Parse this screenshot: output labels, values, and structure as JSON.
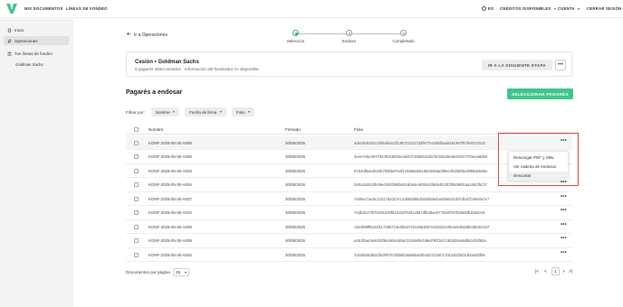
{
  "topnav": {
    "mis_documentos": "MIS DOCUMENTOS",
    "lineas_fondeo": "LÍNEAS DE FONDEO",
    "language": "ES",
    "creditos": "CRÉDITOS DISPONIBLES",
    "cuenta": "CUENTA",
    "cerrar_sesion": "CERRAR SESIÓN"
  },
  "sidebar": {
    "items": [
      {
        "label": "Inicio",
        "icon": "home-icon"
      },
      {
        "label": "Operaciones",
        "icon": "transfer-icon"
      },
      {
        "label": "Tus líneas de fondeo",
        "icon": "bank-icon"
      }
    ],
    "sub_item": "Goldman Sachs"
  },
  "back_link": "Ir a Operaciones",
  "stepper": {
    "steps": [
      {
        "label": "Selección",
        "state": "active"
      },
      {
        "label": "Endoso",
        "state": "pending"
      },
      {
        "label": "Completado",
        "state": "pending"
      }
    ]
  },
  "summary_card": {
    "title": "Cesión • Goldman Sachs",
    "subtitle": "9 pagarés seleccionados · Información del fondeador no disponible",
    "next_button": "IR A LA SIGUIENTE ETAPA",
    "more_button": "•••"
  },
  "section": {
    "title": "Pagarés a endosar",
    "select_button": "SELECCIONAR PAGARÉS"
  },
  "filters": {
    "label": "Filtrar por:",
    "chips": [
      "Nombre",
      "Fecha de firma",
      "Folio"
    ]
  },
  "table": {
    "headers": {
      "nombre": "Nombre",
      "firmado": "Firmado",
      "folio": "Folio"
    },
    "rows": [
      {
        "nombre": "KONF-2025-05-30-A006",
        "firmado": "30/05/2025",
        "folio": "adec92633ccc6f8cd5ec3f1287212c27d3f977ce336f2ad446c367f67fe3017013"
      },
      {
        "nombre": "KONF-2025-05-30-A005",
        "firmado": "30/05/2025",
        "folio": "3eee7ebe2677944001bf50ec9d4373056b3cbb78cb6249ebe82347704eea8d94"
      },
      {
        "nombre": "KONF-2025-05-30-A003",
        "firmado": "30/05/2025",
        "folio": "5753df9ae4b34b7008bd7e6f1c5556ab51863d469a3f9ee4f0dd6f5cd898deb65e"
      },
      {
        "nombre": "KONF-2025-05-30-A004",
        "firmado": "30/05/2025",
        "folio": "045cda2533b49edcb0f288b4616b84e493b2438d44b32f2f55366fcaa2451f5c37"
      },
      {
        "nombre": "KONF-2025-05-30-A007",
        "firmado": "30/05/2025",
        "folio": "7eb5ec7aedc1241752d17ec1d55dd65af19ddabeba490e52cd57dbd7046e0a7e7"
      },
      {
        "nombre": "KONF-2025-05-30-A010",
        "firmado": "30/05/2025",
        "folio": "74db3e17f57b291619fd1515d784f12b67dfb48ae9770a9f787b29e8fb1b5e0c9"
      },
      {
        "nombre": "KONF-2025-05-30-A009",
        "firmado": "30/05/2025",
        "folio": "c254f99ff8233f117385714e0b6d74914954b07e283332c954e84fa58b03b461347"
      },
      {
        "nombre": "KONF-2025-05-30-A008",
        "firmado": "30/05/2025",
        "folio": "a461fbae3e8432f8e383e0d59c321690bcb88d79f1b47c383d3ea9d5b0cb3f9da"
      },
      {
        "nombre": "KONF-2025-05-30-A002",
        "firmado": "30/05/2025",
        "folio": "1016f626d5dcfbc9f5757d5b0b3a86dab4fe4d21f1807c21b2d2f2d3c83a0d0f68"
      }
    ]
  },
  "dropdown": {
    "items": [
      "Descargar PDF y XML",
      "Ver cadena de endosos",
      "Descartar"
    ]
  },
  "footer": {
    "per_page_label": "Documentos por página",
    "per_page_value": "25",
    "current_page": "1",
    "first": "|<",
    "prev": "<",
    "next": ">",
    "last": ">|"
  },
  "colors": {
    "accent_green": "#3fc58b",
    "step_active": "#3fae6e",
    "highlight_red": "#e04848"
  }
}
